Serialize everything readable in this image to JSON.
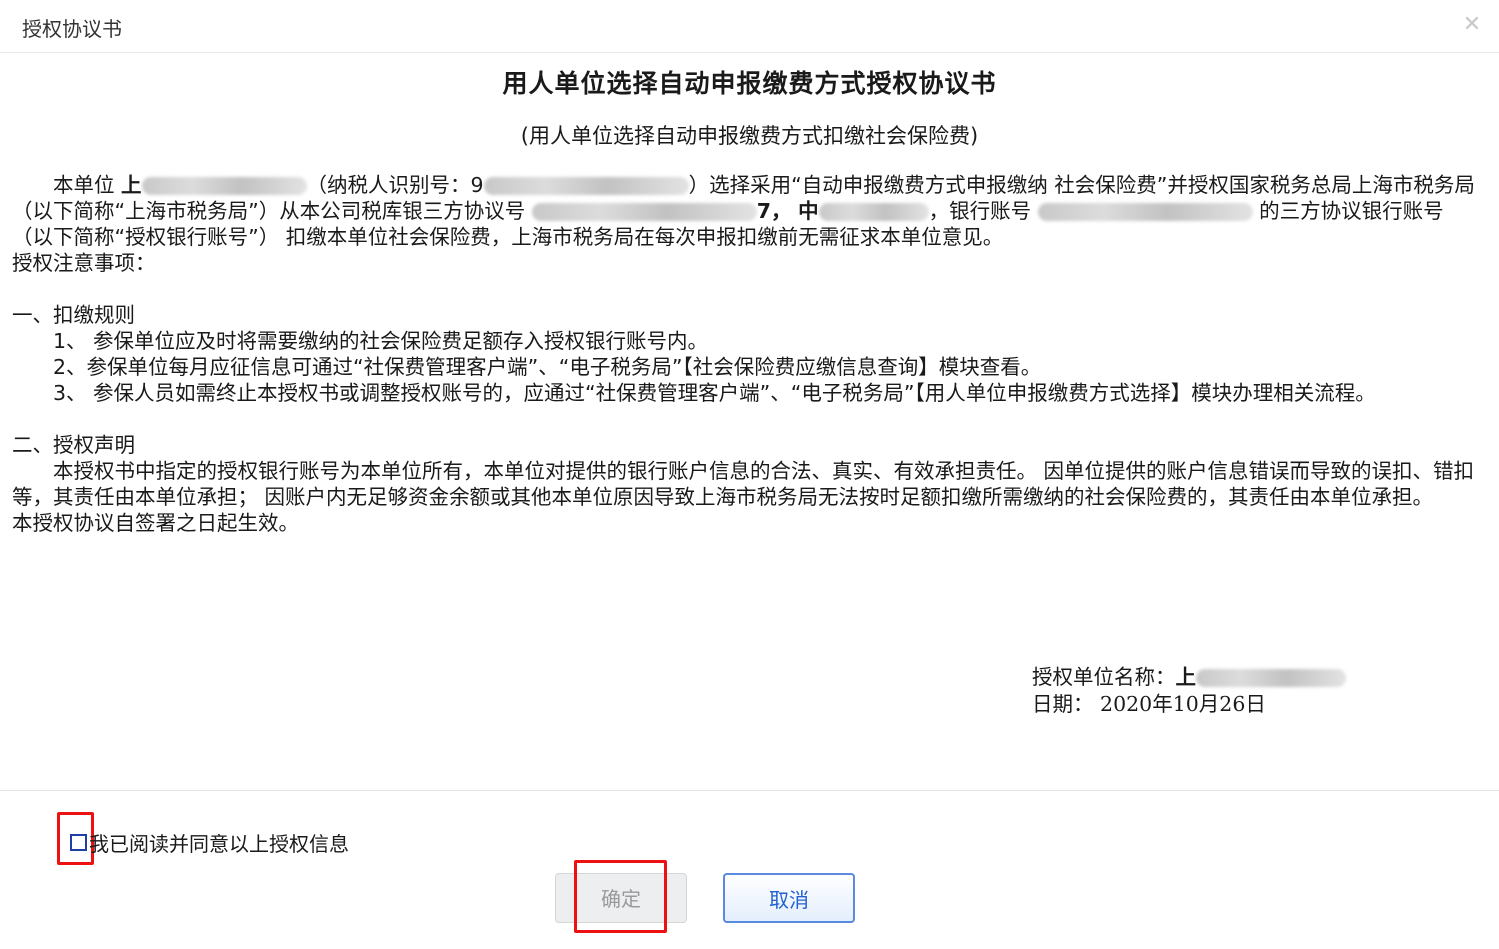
{
  "dialog": {
    "title": "授权协议书",
    "close_icon": "close-icon"
  },
  "document": {
    "title": "用人单位选择自动申报缴费方式授权协议书",
    "subtitle": "(用人单位选择自动申报缴费方式扣缴社会保险费)",
    "intro": {
      "p1": "本单位",
      "p1b": "上",
      "p2": "（纳税人识别号：9",
      "p3": "）选择采用“自动申报缴费方式申报缴纳 社会保险费”并授权国家税务总局上海市税务局（以下简称“上海市税务局”）从本公司税库银三方协议号",
      "p4": "7，",
      "p4b": "中",
      "p5": "，银行账号",
      "p6": "的三方协议银行账号（以下简称“授权银行账号”） 扣缴本单位社会保险费，上海市税务局在每次申报扣缴前无需征求本单位意见。"
    },
    "notice_label": "授权注意事项：",
    "section1": {
      "heading": "一、扣缴规则",
      "items": [
        "1、 参保单位应及时将需要缴纳的社会保险费足额存入授权银行账号内。",
        "2、参保单位每月应征信息可通过“社保费管理客户端”、“电子税务局”【社会保险费应缴信息查询】模块查看。",
        "3、 参保人员如需终止本授权书或调整授权账号的，应通过“社保费管理客户端”、“电子税务局”【用人单位申报缴费方式选择】模块办理相关流程。"
      ]
    },
    "section2": {
      "heading": "二、授权声明",
      "text": "本授权书中指定的授权银行账号为本单位所有，本单位对提供的银行账户信息的合法、真实、有效承担责任。 因单位提供的账户信息错误而导致的误扣、错扣等，其责任由本单位承担； 因账户内无足够资金余额或其他本单位原因导致上海市税务局无法按时足额扣缴所需缴纳的社会保险费的，其责任由本单位承担。",
      "effective": "本授权协议自签署之日起生效。"
    },
    "signature": {
      "unit_label": "授权单位名称：",
      "unit_value": "上",
      "date_label": "日期：",
      "date_value": "2020年10月26日"
    }
  },
  "footer": {
    "agree_label": "我已阅读并同意以上授权信息",
    "agree_checked": false,
    "ok_label": "确定",
    "ok_disabled": true,
    "cancel_label": "取消"
  },
  "colors": {
    "highlight": "#ee1111",
    "checkbox_border": "#1f3fa8",
    "cancel_text": "#2160d0"
  }
}
